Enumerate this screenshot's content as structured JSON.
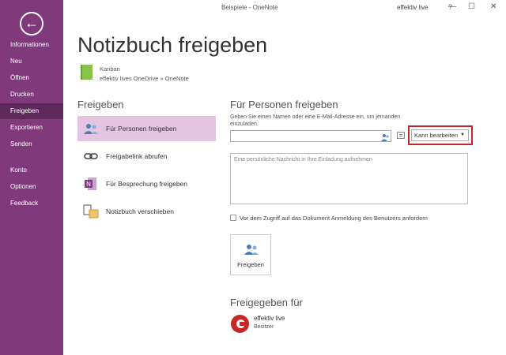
{
  "window": {
    "title": "Beispiele - OneNote",
    "user": "effektiv live",
    "help": "?",
    "minimize": "—",
    "maximize": "☐",
    "close": "✕"
  },
  "sidebar": {
    "back_icon": "←",
    "items": [
      {
        "label": "Informationen"
      },
      {
        "label": "Neu"
      },
      {
        "label": "Öffnen"
      },
      {
        "label": "Drucken"
      },
      {
        "label": "Freigeben"
      },
      {
        "label": "Exportieren"
      },
      {
        "label": "Senden"
      },
      {
        "label": "Konto"
      },
      {
        "label": "Optionen"
      },
      {
        "label": "Feedback"
      }
    ],
    "active": "Freigeben"
  },
  "page": {
    "title": "Notizbuch freigeben"
  },
  "notebook": {
    "name": "Kanban",
    "path": "effektiv lives OneDrive » OneNote"
  },
  "share_section": {
    "heading": "Freigeben",
    "options": [
      {
        "label": "Für Personen freigeben"
      },
      {
        "label": "Freigabelink abrufen"
      },
      {
        "label": "Für Besprechung freigeben"
      },
      {
        "label": "Notizbuch verschieben"
      }
    ]
  },
  "people": {
    "heading": "Für Personen freigeben",
    "description": "Geben Sie einen Namen oder eine E-Mail-Adresse ein, um jemanden einzuladen.",
    "name_value": "",
    "permission": "Kann bearbeiten",
    "caret": "▼",
    "message_placeholder": "Eine persönliche Nachricht in Ihre Einladung aufnehmen",
    "require_signin_label": "Vor dem Zugriff auf das Dokument Anmeldung des Benutzers anfordern",
    "share_button": "Freigeben"
  },
  "shared_with": {
    "heading": "Freigegeben für",
    "owner": {
      "name": "effektiv live",
      "role": "Besitzer"
    }
  },
  "colors": {
    "accent": "#80397b",
    "selected": "#e4c4e0",
    "highlight": "#c8242b"
  }
}
